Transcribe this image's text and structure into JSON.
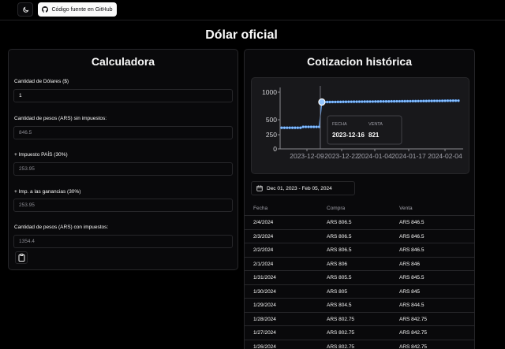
{
  "header": {
    "github_label": "Código fuente en GitHub",
    "theme_icon": "moon-icon",
    "github_icon": "github-icon"
  },
  "page_title": "Dólar oficial",
  "calculator": {
    "title": "Calculadora",
    "fields": [
      {
        "label": "Cantidad de Dólares ($)",
        "value": "1"
      },
      {
        "label": "Cantidad de pesos (ARS) sin impuestos:",
        "value": "846.5"
      },
      {
        "label": "+ Impuesto PAÍS (30%)",
        "value": "253.95"
      },
      {
        "label": "+ Imp. a las ganancias (30%)",
        "value": "253.95"
      },
      {
        "label": "Cantidad de pesos (ARS) con impuestos:",
        "value": "1354.4"
      }
    ],
    "copy_icon": "clipboard-icon"
  },
  "history": {
    "title": "Cotizacion histórica",
    "date_range": "Dec 01, 2023 - Feb 05, 2024",
    "calendar_icon": "calendar-icon",
    "columns": [
      "Fecha",
      "Compra",
      "Venta"
    ],
    "rows": [
      [
        "2/4/2024",
        "ARS 806.5",
        "ARS 846.5"
      ],
      [
        "2/3/2024",
        "ARS 806.5",
        "ARS 846.5"
      ],
      [
        "2/2/2024",
        "ARS 806.5",
        "ARS 846.5"
      ],
      [
        "2/1/2024",
        "ARS 806",
        "ARS 846"
      ],
      [
        "1/31/2024",
        "ARS 805.5",
        "ARS 845.5"
      ],
      [
        "1/30/2024",
        "ARS 805",
        "ARS 845"
      ],
      [
        "1/29/2024",
        "ARS 804.5",
        "ARS 844.5"
      ],
      [
        "1/28/2024",
        "ARS 802.75",
        "ARS 842.75"
      ],
      [
        "1/27/2024",
        "ARS 802.75",
        "ARS 842.75"
      ],
      [
        "1/26/2024",
        "ARS 802.75",
        "ARS 842.75"
      ]
    ]
  },
  "chart_data": {
    "type": "line",
    "ylim": [
      0,
      1000
    ],
    "yticks": [
      "1000",
      "500",
      "250",
      "0"
    ],
    "xticks": [
      "2023-12-09",
      "2023-12-22",
      "2024-01-04",
      "2024-01-17",
      "2024-02-04"
    ],
    "series": [
      {
        "values": [
          366,
          366,
          366,
          366,
          366,
          366,
          366,
          366,
          381,
          381,
          381,
          381,
          381,
          381,
          381,
          821,
          821,
          822,
          822,
          823,
          823,
          824,
          824,
          825,
          825,
          826,
          826,
          827,
          827,
          828,
          828,
          829,
          829,
          830,
          830,
          831,
          831,
          832,
          832,
          833,
          833,
          834,
          834,
          835,
          835,
          836,
          836,
          837,
          837,
          838,
          838,
          839,
          839,
          840,
          840,
          841,
          841,
          842,
          842,
          842,
          843,
          844,
          845,
          845,
          846,
          846,
          846
        ]
      }
    ],
    "tooltip": {
      "fecha_label": "FECHA",
      "venta_label": "VENTA",
      "fecha": "2023-12-16",
      "venta": "821"
    },
    "line_color": "#60a5fa"
  }
}
